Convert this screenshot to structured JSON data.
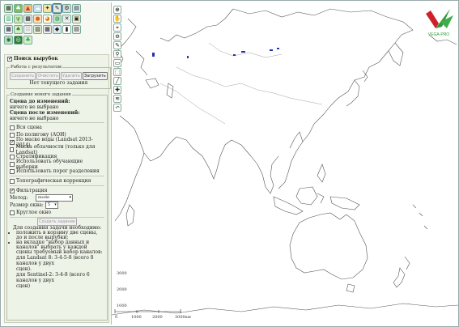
{
  "toolbar": {
    "icons": [
      "layer-icon",
      "leaf-icon",
      "fire-icon",
      "cloud-icon",
      "satellite-icon",
      "wrench-icon",
      "gear-icon",
      "table-icon",
      "chart-icon",
      "grass-icon",
      "grid-icon",
      "pin-icon",
      "pie-icon",
      "earth-icon",
      "tools-icon",
      "image-icon",
      "globe-icon",
      "forest-icon",
      "tree-icon"
    ]
  },
  "panel": {
    "title": "Поиск вырубок",
    "results": {
      "legend": "Работа с результатом",
      "buttons": [
        "Сохранить",
        "Очистить",
        "Удалить",
        "Загрузить"
      ],
      "status": "Нет текущего задания"
    },
    "new_task": {
      "legend": "Создание нового задания",
      "before_label": "Сцена до изменений:",
      "before_value": "ничего не выбрано",
      "after_label": "Сцена после изменений:",
      "after_value": "ничего не выбрано",
      "options": [
        {
          "label": "Вся сцена",
          "checked": false
        },
        {
          "label": "По полигону (АОИ)",
          "checked": false
        },
        {
          "label": "По маске воды (Landsat 2013-2014)",
          "checked": true
        },
        {
          "label": "Маска облачности (только для Landsat)",
          "checked": false
        },
        {
          "label": "Стратификация",
          "checked": false
        },
        {
          "label": "Использовать обучающие выборки",
          "checked": false
        },
        {
          "label": "Использовать порог разделения",
          "checked": false
        }
      ],
      "topo": "Топографическая коррекция",
      "filter": "Фильтрация",
      "method_label": "Метод:",
      "method_value": "mode",
      "window_label": "Размер окна:",
      "window_value": "5",
      "round_window": "Круглое окно",
      "create_button": "Создать задание",
      "help_title": "Для создания задачи необходимо:",
      "help_items": [
        "положить в корзину две сцены, до и после вырубки;",
        "на вкладке \"выбор данных и каналов\" выбрать у каждой сцены требуемый набор каналов:"
      ],
      "help_lines": [
        "для Landsat 8: 3-4-5-8 (всего 8 каналов у двух",
        "сцен).",
        "для Sentinel-2: 3-4-8 (всего 6 каналов у двух",
        "сцен)"
      ]
    }
  },
  "map": {
    "tools": [
      "zoom-in-icon",
      "hand-icon",
      "select-icon",
      "zoom-out-icon",
      "pencil-icon",
      "magnify-icon",
      "measure-icon",
      "rect-icon",
      "line-icon",
      "tool-icon",
      "layers-icon",
      "undo-icon"
    ],
    "scale_labels": [
      "0",
      "1000",
      "2000",
      "3000км"
    ],
    "y_labels": [
      "3000",
      "2000",
      "1000"
    ],
    "logo_text": "VEGA-PRO",
    "logo_colors": {
      "green": "#2f9a3a",
      "red": "#d0202a"
    }
  }
}
